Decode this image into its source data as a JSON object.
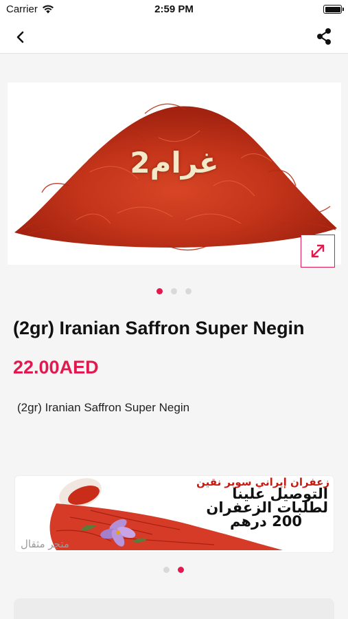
{
  "status_bar": {
    "carrier": "Carrier",
    "time": "2:59 PM",
    "icons": [
      "wifi-icon",
      "battery-icon"
    ]
  },
  "nav": {
    "back_icon": "chevron-left-icon",
    "share_icon": "share-icon"
  },
  "gallery": {
    "overlay_text": "2غرام",
    "expand_icon": "expand-icon",
    "slide_count": 3,
    "active_index": 0
  },
  "product": {
    "title": "(2gr) Iranian Saffron Super Negin",
    "price": "22.00AED",
    "description": "(2gr) Iranian Saffron Super Negin"
  },
  "banner": {
    "headline": "زعفران إيراني سوبر نقين",
    "line1": "التوصيل علينا",
    "line2": "لطلبات الزعفران",
    "line3": "200 درهم",
    "store_name": "متجر مثقال",
    "slide_count": 2,
    "active_index": 1
  },
  "colors": {
    "accent": "#e2194f",
    "background": "#f5f5f5",
    "saffron": "#c8321a"
  }
}
